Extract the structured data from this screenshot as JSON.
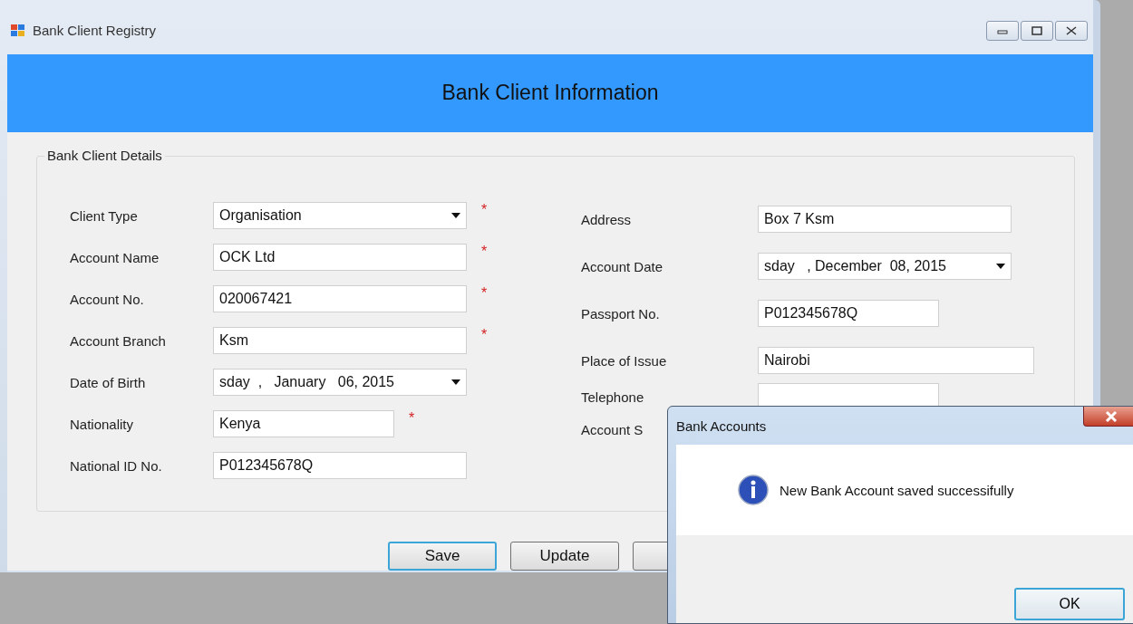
{
  "window": {
    "title": "Bank Client Registry"
  },
  "header": {
    "title": "Bank Client Information"
  },
  "group": {
    "title": "Bank Client Details"
  },
  "left_fields": [
    {
      "label": "Client Type",
      "kind": "combo",
      "value": "Organisation",
      "mark": "*"
    },
    {
      "label": "Account Name",
      "kind": "text",
      "value": "OCK Ltd",
      "mark": "*"
    },
    {
      "label": "Account No.",
      "kind": "text",
      "value": "020067421",
      "mark": "*"
    },
    {
      "label": "Account Branch",
      "kind": "text",
      "value": "Ksm",
      "mark": "*"
    },
    {
      "label": "Date of Birth",
      "kind": "date",
      "value": "sday  ,   January   06, 2015"
    },
    {
      "label": "Nationality",
      "kind": "short",
      "value": "Kenya",
      "mark": "*"
    },
    {
      "label": "National ID No.",
      "kind": "text",
      "value": "P012345678Q"
    }
  ],
  "right_fields": [
    {
      "label": "Address",
      "kind": "text",
      "value": "Box 7 Ksm"
    },
    {
      "label": "Account Date",
      "kind": "date",
      "value": "sday   , December  08, 2015"
    },
    {
      "label": "Passport No.",
      "kind": "short",
      "value": "P012345678Q"
    },
    {
      "label": "Place of Issue",
      "kind": "wide",
      "value": "Nairobi"
    },
    {
      "label": "Telephone",
      "kind": "short"
    },
    {
      "label": "Account S",
      "kind": "none"
    }
  ],
  "buttons": [
    {
      "kind": "text",
      "label": "Save",
      "default": true
    },
    {
      "kind": "text",
      "label": "Update",
      "default": false
    },
    {
      "kind": "covered",
      "default": false
    }
  ],
  "dialog": {
    "title": "Bank Accounts",
    "message": "New Bank Account saved successifully",
    "button": "OK"
  }
}
